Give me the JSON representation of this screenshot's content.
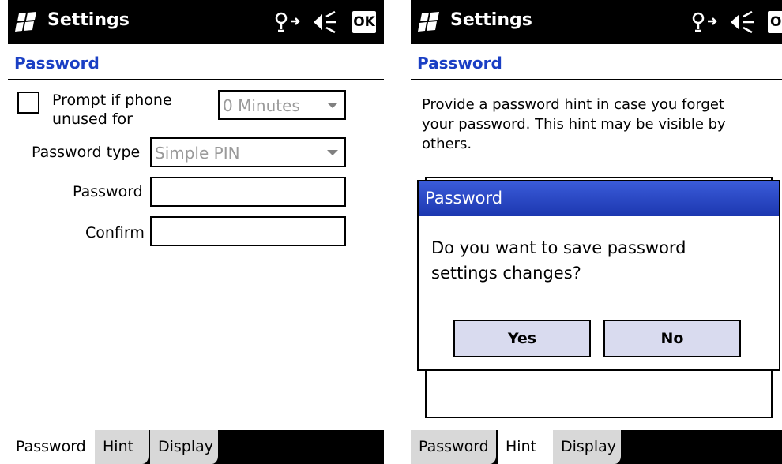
{
  "left_screen": {
    "title": "Settings",
    "ok_label": "OK",
    "section_title": "Password",
    "prompt_checkbox_label_line1": "Prompt if phone",
    "prompt_checkbox_label_line2": "unused for",
    "prompt_checked": false,
    "timeout_value": "0 Minutes",
    "password_type_label": "Password type",
    "password_type_value": "Simple PIN",
    "password_label": "Password",
    "password_value": "",
    "confirm_label": "Confirm",
    "confirm_value": "",
    "tabs": [
      "Password",
      "Hint",
      "Display"
    ],
    "active_tab": "Password"
  },
  "right_screen": {
    "title": "Settings",
    "ok_label": "OK",
    "section_title": "Password",
    "hint_text_line1": "Provide a password hint in case you forget",
    "hint_text_line2": "your password.  This hint may be visible by",
    "hint_text_line3": "others.",
    "dialog": {
      "title": "Password",
      "message_line1": "Do you want to save password",
      "message_line2": "settings changes?",
      "yes_label": "Yes",
      "no_label": "No"
    },
    "tabs": [
      "Password",
      "Hint",
      "Display"
    ],
    "active_tab": "Hint"
  },
  "colors": {
    "title_bar_bg": "#000000",
    "section_title": "#1a3fc4",
    "dialog_title_bg": "#2a47c4",
    "dialog_button_bg": "#d9dbef"
  },
  "icons": [
    "windows-start-icon",
    "connectivity-icon",
    "speaker-muted-icon"
  ]
}
